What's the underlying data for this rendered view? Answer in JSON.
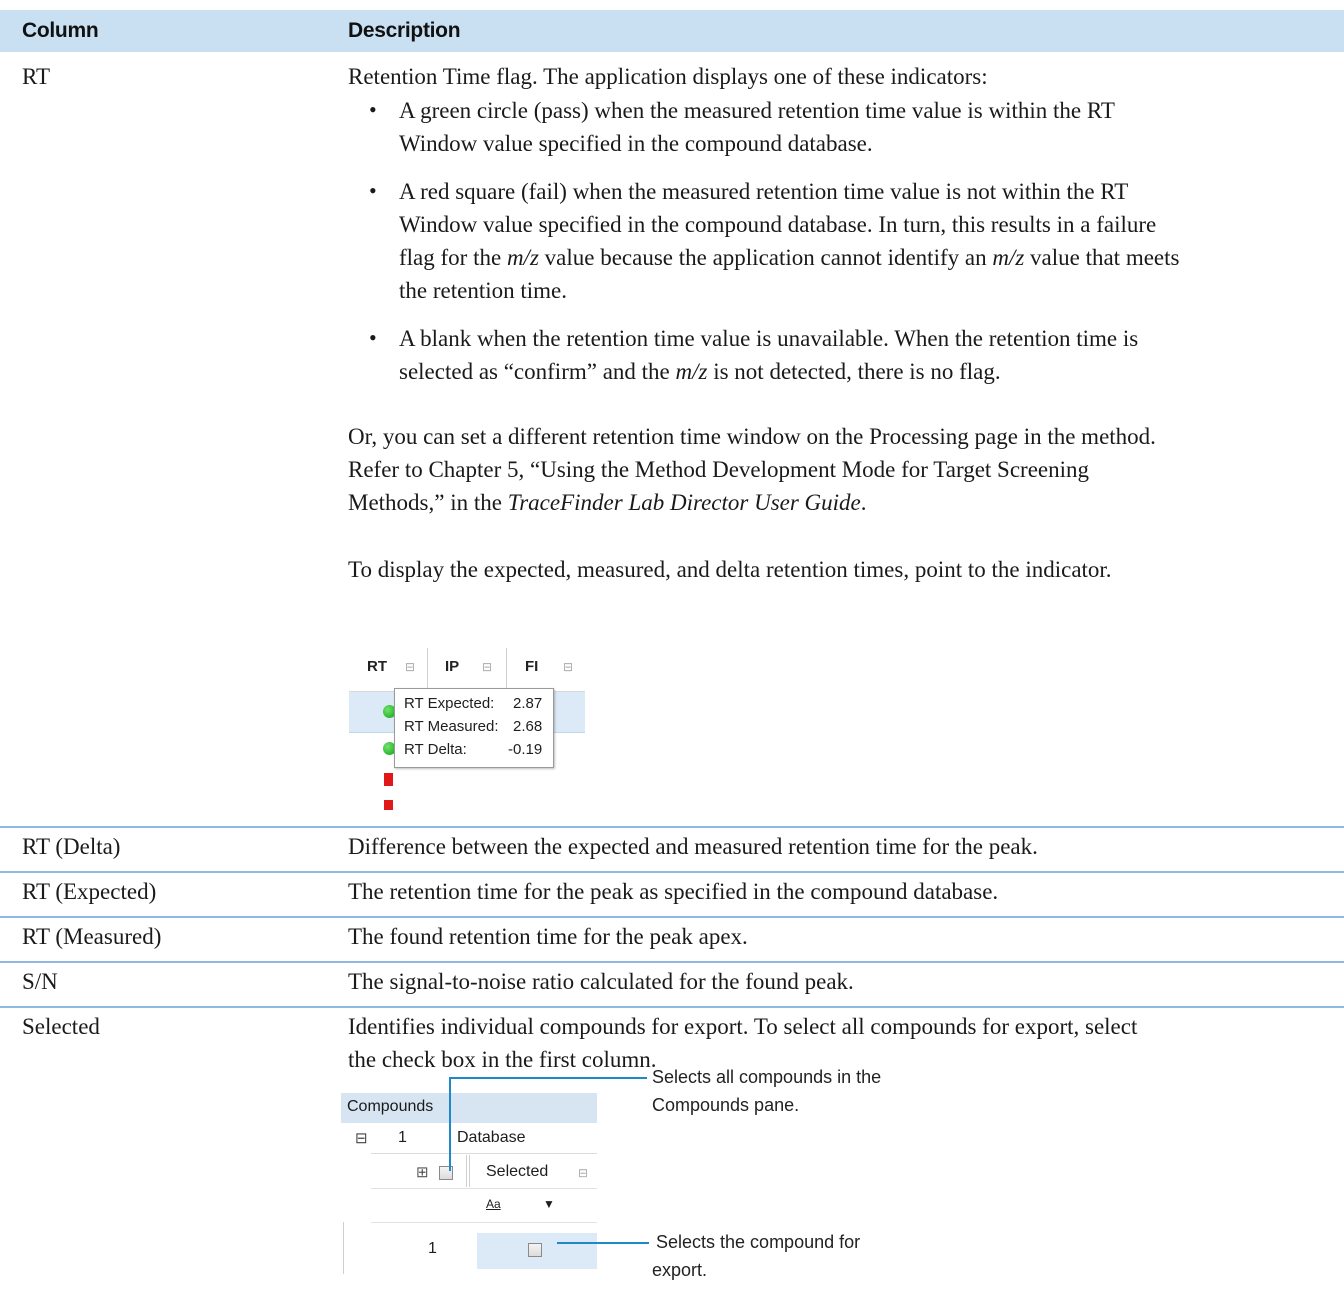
{
  "header": {
    "col1": "Column",
    "col2": "Description"
  },
  "rt": {
    "name": "RT",
    "intro": "Retention Time flag. The application displays one of these indicators:",
    "bullet": "•",
    "b1": [
      "A green circle (pass) when the measured retention time value is within the RT",
      "Window value specified in the compound database."
    ],
    "b2": [
      "A red square (fail) when the measured retention time value is not within the RT",
      "Window value specified in the compound database. In turn, this results in a failure"
    ],
    "b2c": {
      "pre": "flag for the ",
      "mz1": "m/z",
      "mid": " value because the application cannot identify an ",
      "mz2": "m/z",
      "post": " value that meets"
    },
    "b2d": "the retention time.",
    "b3": "A blank when the retention time value is unavailable. When the retention time is",
    "b3b": {
      "pre": "selected as “confirm” and the ",
      "mz": "m/z",
      "post": " is not detected, there is no flag."
    },
    "p1": "Or, you can set a different retention time window on the Processing page in the method.",
    "p2": "Refer to Chapter 5, “Using the Method Development Mode for Target Screening",
    "p3": {
      "pre": "Methods,” in the ",
      "em": "TraceFinder Lab Director User Guide",
      "post": "."
    },
    "p4": "To display the expected, measured, and delta retention times, point to the indicator.",
    "shot": {
      "cols": [
        "RT",
        "IP",
        "FI"
      ],
      "pin": "⊟",
      "tip": {
        "expected_label": "RT Expected:",
        "expected": "2.87",
        "measured_label": "RT Measured:",
        "measured": "2.68",
        "delta_label": "RT Delta:",
        "delta": "-0.19"
      }
    }
  },
  "rows": [
    {
      "name": "RT (Delta)",
      "desc": "Difference between the expected and measured retention time for the peak."
    },
    {
      "name": "RT (Expected)",
      "desc": "The retention time for the peak as specified in the compound database."
    },
    {
      "name": "RT (Measured)",
      "desc": "The found retention time for the peak apex."
    },
    {
      "name": "S/N",
      "desc": "The signal-to-noise ratio calculated for the found peak."
    }
  ],
  "selected": {
    "name": "Selected",
    "desc1": "Identifies individual compounds for export. To select all compounds for export, select",
    "desc2": "the check box in the first column.",
    "shot": {
      "pane": "Compounds",
      "expander": "⊟",
      "row_num": "1",
      "db": "Database",
      "col": "Selected",
      "pin": "⊟",
      "filter_aa": "Aa",
      "filter_arrow": "▼",
      "row2": "1"
    },
    "callout1": [
      "Selects all compounds in the",
      "Compounds pane."
    ],
    "callout2": [
      "Selects the compound for",
      "export."
    ]
  }
}
